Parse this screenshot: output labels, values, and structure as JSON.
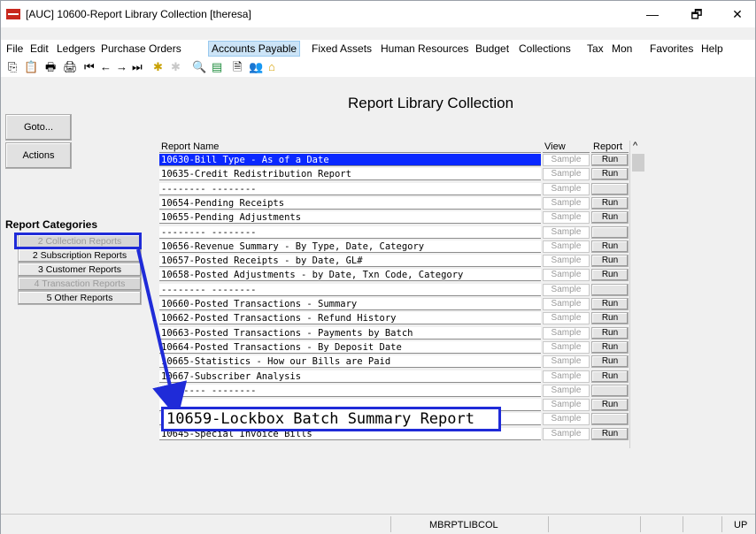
{
  "window": {
    "title": "[AUC] 10600-Report Library Collection [theresa]",
    "controls": {
      "minimize": "—",
      "restore": "🗗",
      "close": "✕"
    }
  },
  "menu": [
    "File",
    "Edit",
    "Ledgers",
    "Purchase Orders",
    "Accounts Payable",
    "Fixed Assets",
    "Human Resources",
    "Budget",
    "Collections",
    "Tax",
    "Mon",
    "Favorites",
    "Help"
  ],
  "page_title": "Report Library Collection",
  "side_buttons": {
    "goto": "Goto...",
    "actions": "Actions"
  },
  "categories": {
    "heading": "Report Categories",
    "items": [
      {
        "label": "2 Collection Reports",
        "state": "disabled"
      },
      {
        "label": "2 Subscription Reports",
        "state": "enabled"
      },
      {
        "label": "3 Customer Reports",
        "state": "enabled"
      },
      {
        "label": "4 Transaction Reports",
        "state": "disabled"
      },
      {
        "label": "5 Other Reports",
        "state": "enabled"
      }
    ]
  },
  "grid": {
    "headers": {
      "name": "Report Name",
      "view": "View",
      "report": "Report",
      "scroll_up": "^"
    },
    "rows": [
      {
        "name": "10630-Bill Type - As of a Date",
        "view": "Sample",
        "report": "Run",
        "selected": true
      },
      {
        "name": "10635-Credit Redistribution Report",
        "view": "Sample",
        "report": "Run"
      },
      {
        "name": "--------  --------",
        "view": "Sample",
        "report": ""
      },
      {
        "name": "10654-Pending Receipts",
        "view": "Sample",
        "report": "Run"
      },
      {
        "name": "10655-Pending Adjustments",
        "view": "Sample",
        "report": "Run"
      },
      {
        "name": "--------  --------",
        "view": "Sample",
        "report": ""
      },
      {
        "name": "10656-Revenue Summary - By Type, Date, Category",
        "view": "Sample",
        "report": "Run"
      },
      {
        "name": "10657-Posted Receipts - by Date, GL#",
        "view": "Sample",
        "report": "Run"
      },
      {
        "name": "10658-Posted Adjustments - by Date, Txn Code, Category",
        "view": "Sample",
        "report": "Run"
      },
      {
        "name": "--------  --------",
        "view": "Sample",
        "report": ""
      },
      {
        "name": "10660-Posted Transactions - Summary",
        "view": "Sample",
        "report": "Run"
      },
      {
        "name": "10662-Posted Transactions - Refund History",
        "view": "Sample",
        "report": "Run"
      },
      {
        "name": "10663-Posted Transactions - Payments by Batch",
        "view": "Sample",
        "report": "Run"
      },
      {
        "name": "10664-Posted Transactions - By Deposit Date",
        "view": "Sample",
        "report": "Run"
      },
      {
        "name": "10665-Statistics - How our Bills are Paid",
        "view": "Sample",
        "report": "Run"
      },
      {
        "name": "10667-Subscriber Analysis",
        "view": "Sample",
        "report": "Run"
      },
      {
        "name": "--------  --------",
        "view": "Sample",
        "report": ""
      },
      {
        "name": "",
        "view": "Sample",
        "report": "Run"
      },
      {
        "name": "",
        "view": "Sample",
        "report": ""
      },
      {
        "name": "10645-Special Invoice Bills",
        "view": "Sample",
        "report": "Run"
      }
    ]
  },
  "callout": {
    "text": "10659-Lockbox Batch Summary Report",
    "color": "#1f2bd8"
  },
  "status": {
    "screen_id": "MBRPTLIBCOL",
    "mode": "UP"
  },
  "colors": {
    "selection": "#0a28ff",
    "callout": "#1f2bd8"
  }
}
